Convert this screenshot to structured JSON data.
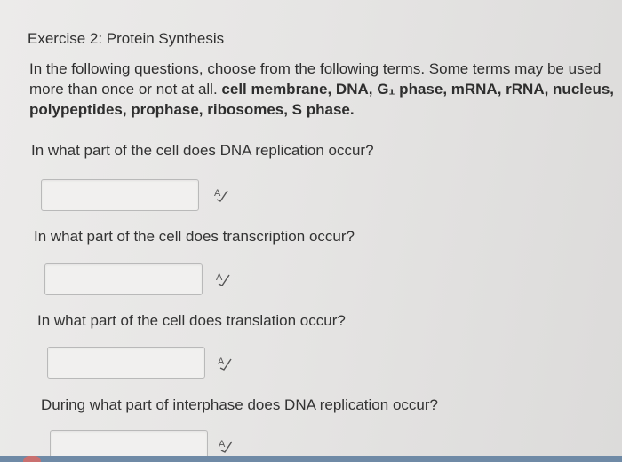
{
  "exercise": {
    "title": "Exercise 2: Protein Synthesis",
    "instructions": "In the following questions, choose from the following terms. Some terms may be used more than once or not at all.",
    "terms": "cell membrane, DNA, G₁ phase, mRNA, rRNA, nucleus, polypeptides, prophase, ribosomes, S phase."
  },
  "questions": [
    {
      "text": "In what part of the cell does DNA replication occur?",
      "value": "",
      "icon": "spellcheck-icon"
    },
    {
      "text": "In what part of the cell does transcription occur?",
      "value": "",
      "icon": "spellcheck-icon"
    },
    {
      "text": "In what part of the cell does translation occur?",
      "value": "",
      "icon": "spellcheck-icon"
    },
    {
      "text": "During what part of interphase does DNA replication occur?",
      "value": "",
      "icon": "spellcheck-icon"
    }
  ],
  "colors": {
    "bottom_bar": "#6f8aa6",
    "bottom_marker": "#c97070"
  }
}
